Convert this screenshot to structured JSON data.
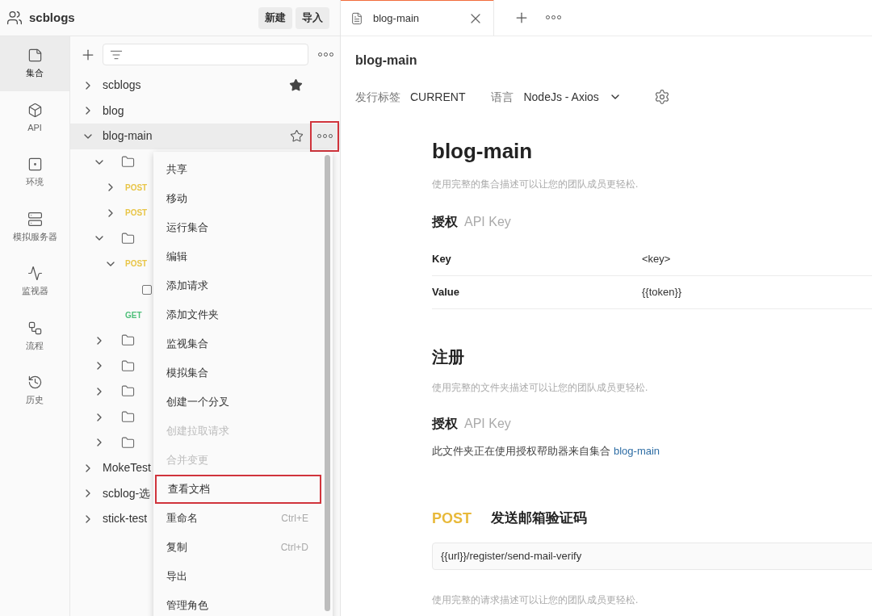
{
  "workspace": {
    "name": "scblogs",
    "buttons": [
      "新建",
      "导入"
    ]
  },
  "rail": [
    {
      "kind": "collections",
      "label": "集合",
      "selected": true
    },
    {
      "kind": "api",
      "label": "API",
      "selected": false
    },
    {
      "kind": "environments",
      "label": "环境",
      "selected": false
    },
    {
      "kind": "mock",
      "label": "模拟服务器",
      "selected": false
    },
    {
      "kind": "monitors",
      "label": "监视器",
      "selected": false
    },
    {
      "kind": "flows",
      "label": "流程",
      "selected": false
    },
    {
      "kind": "history",
      "label": "历史",
      "selected": false
    }
  ],
  "tree": [
    {
      "kind": "collection",
      "label": "scblogs",
      "expanded": false,
      "starred": true,
      "selected": false
    },
    {
      "kind": "collection",
      "label": "blog",
      "expanded": false,
      "selected": false
    },
    {
      "kind": "collection",
      "label": "blog-main",
      "expanded": true,
      "starred": false,
      "selected": true,
      "more_highlighted": true,
      "children": [
        {
          "kind": "folder",
          "expanded": true,
          "children": [
            {
              "kind": "request",
              "method": "POST",
              "color": "#e8c547",
              "expanded": false
            },
            {
              "kind": "request",
              "method": "POST",
              "color": "#e8c547",
              "expanded": false
            }
          ]
        },
        {
          "kind": "folder",
          "expanded": true,
          "children": [
            {
              "kind": "request",
              "method": "POST",
              "color": "#e8c547",
              "expanded": true,
              "children": [
                {
                  "kind": "example"
                }
              ]
            },
            {
              "kind": "request",
              "method": "GET",
              "color": "#4fbf7a"
            }
          ]
        },
        {
          "kind": "folder",
          "expanded": false
        },
        {
          "kind": "folder",
          "expanded": false
        },
        {
          "kind": "folder",
          "expanded": false
        },
        {
          "kind": "folder",
          "expanded": false
        },
        {
          "kind": "folder",
          "expanded": false
        }
      ]
    },
    {
      "kind": "collection",
      "label": "MokeTest",
      "expanded": false,
      "selected": false
    },
    {
      "kind": "collection",
      "label": "scblog-选",
      "expanded": false,
      "selected": false
    },
    {
      "kind": "collection",
      "label": "stick-test",
      "expanded": false,
      "selected": false
    }
  ],
  "menu": [
    {
      "label": "共享",
      "disabled": false,
      "highlighted": false
    },
    {
      "label": "移动",
      "disabled": false,
      "highlighted": false
    },
    {
      "label": "运行集合",
      "disabled": false,
      "highlighted": false
    },
    {
      "label": "编辑",
      "disabled": false,
      "highlighted": false
    },
    {
      "label": "添加请求",
      "disabled": false,
      "highlighted": false
    },
    {
      "label": "添加文件夹",
      "disabled": false,
      "highlighted": false
    },
    {
      "label": "监视集合",
      "disabled": false,
      "highlighted": false
    },
    {
      "label": "模拟集合",
      "disabled": false,
      "highlighted": false
    },
    {
      "label": "创建一个分叉",
      "disabled": false,
      "highlighted": false
    },
    {
      "label": "创建拉取请求",
      "disabled": true,
      "highlighted": false
    },
    {
      "label": "合并变更",
      "disabled": true,
      "highlighted": false
    },
    {
      "label": "查看文档",
      "disabled": false,
      "highlighted": true
    },
    {
      "label": "重命名",
      "shortcut": "Ctrl+E",
      "disabled": false,
      "highlighted": false
    },
    {
      "label": "复制",
      "shortcut": "Ctrl+D",
      "disabled": false,
      "highlighted": false
    },
    {
      "label": "导出",
      "disabled": false,
      "highlighted": false
    },
    {
      "label": "管理角色",
      "disabled": false,
      "highlighted": false
    }
  ],
  "tabs": [
    {
      "label": "blog-main",
      "selected": true
    }
  ],
  "doc_header": {
    "title": "blog-main",
    "release_label": "发行标签",
    "release_value": "CURRENT",
    "language_label": "语言",
    "language_value": "NodeJs - Axios"
  },
  "doc": {
    "title": "blog-main",
    "description": "使用完整的集合描述可以让您的团队成员更轻松.",
    "auth_heading": "授权",
    "auth_type": "API Key",
    "auth_rows": [
      {
        "key": "Key",
        "value": "<key>"
      },
      {
        "key": "Value",
        "value": "{{token}}"
      }
    ],
    "folder": {
      "title": "注册",
      "description": "使用完整的文件夹描述可以让您的团队成员更轻松.",
      "auth_heading": "授权",
      "auth_type": "API Key",
      "auth_note": "此文件夹正在使用授权帮助器来自集合",
      "auth_link": "blog-main"
    },
    "request": {
      "method": "POST",
      "color": "#e8b93a",
      "name": "发送邮箱验证码",
      "url": "{{url}}/register/send-mail-verify",
      "description": "使用完整的请求描述可以让您的团队成员更轻松."
    }
  }
}
